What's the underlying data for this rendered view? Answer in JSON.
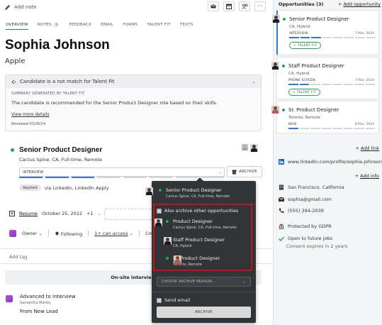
{
  "toolbar": {
    "add_note": "Add note"
  },
  "tabs": [
    {
      "label": "OVERVIEW"
    },
    {
      "label": "NOTES",
      "count": "1"
    },
    {
      "label": "FEEDBACK"
    },
    {
      "label": "EMAIL"
    },
    {
      "label": "FORMS"
    },
    {
      "label": "TALENT FIT"
    },
    {
      "label": "TEXTS"
    }
  ],
  "candidate": {
    "name": "Sophia Johnson",
    "company": "Apple"
  },
  "talent_fit": {
    "header": "Candidate is a not match for Talent Fit",
    "summary_label": "SUMMARY GENERATED BY TALENT FIT",
    "summary": "The candidate is recommended for the Senior Product Designer role based on their skills.",
    "link": "View more details",
    "reviewed": "Reviewed 03/26/24"
  },
  "opportunity": {
    "title": "Senior Product Designer",
    "subtitle": "Cactus Spine, CA, Full-time, Remote",
    "stage": "INTERVIEW",
    "stage_progress": 0.35,
    "archive_label": "ARCHIVE",
    "applied_badge": "Applied",
    "applied_via": "via LinkedIn, LinkedIn Apply"
  },
  "resume": {
    "label": "Resume",
    "date": "October 25, 2022",
    "extra": "+1"
  },
  "owner_row": {
    "owner": "Owner",
    "following": "Following",
    "access": "1+ can access",
    "created": "Created Tu"
  },
  "tag": {
    "placeholder": "Add tag"
  },
  "interview_bar": "On-site Interview",
  "activity": {
    "title": "Advanced to Interview",
    "by": "Samantha Marley",
    "from": "From New Lead"
  },
  "right": {
    "header": "Opportunities (3)",
    "add_opportunity": "Add opportunity",
    "cards": [
      {
        "title": "Senior Product Designer",
        "location": "CA, Hybrid",
        "stage": "INTERVIEW",
        "date": "7 Mar, 2024",
        "fit": "TALENT FIT",
        "progress": 0.35
      },
      {
        "title": "Staff Product Designer",
        "location": "CA, Hybrid",
        "stage": "PHONE SCREEN",
        "date": "7 Mar, 2024",
        "fit": "TALENT FIT",
        "progress": 0.25
      },
      {
        "title": "Sr. Product Designer",
        "location": "Toronto, Remote",
        "stage": "NEW",
        "date": "8 Mar, 2024",
        "progress": 0.1
      }
    ],
    "add_link": "Add link",
    "linkedin": "www.linkedin.com/profile/sophia-johnson",
    "add_info": "Add info",
    "location": "San Francisco, California",
    "email": "sophia@gmail.com",
    "phone": "(555) 394-2039",
    "gdpr": "Protected by GDPR",
    "open_jobs": "Open to future jobs",
    "consent": "Consent expires in 2 years"
  },
  "popup": {
    "current": {
      "title": "Senior Product Designer",
      "sub": "Cactus Spine, CA, Full-time, Remote"
    },
    "also_archive": "Also archive other opportunities",
    "others": [
      {
        "title": "Product Designer",
        "sub": "Cactus Spine, CA, Full-time, Remote"
      },
      {
        "title": "Staff Product Designer",
        "sub": "CA, Hybrid"
      },
      {
        "title": "Sr. Product Designer",
        "sub": "Toronto, Remote"
      }
    ],
    "reason_placeholder": "CHOOSE ARCHIVE REASON...",
    "send_email": "Send email",
    "archive_button": "ARCHIVE"
  },
  "colors": {
    "accent": "#2f7bd0",
    "success": "#1fab4e",
    "highlight": "#c0151b",
    "popup_bg": "#323538"
  }
}
